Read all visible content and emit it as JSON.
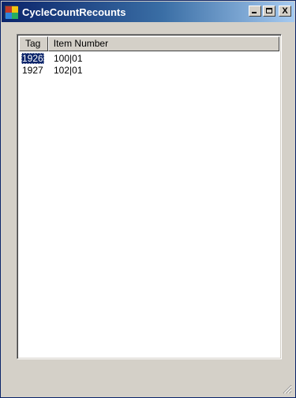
{
  "window": {
    "title": "CycleCountRecounts",
    "icon": "app-window-icon",
    "controls": {
      "minimize_icon": "minimize-icon",
      "maximize_icon": "maximize-icon",
      "close_label": "X"
    }
  },
  "list": {
    "columns": [
      {
        "label": "Tag"
      },
      {
        "label": "Item Number"
      }
    ],
    "rows": [
      {
        "tag": "1926",
        "item_number": "100|01",
        "selected": true
      },
      {
        "tag": "1927",
        "item_number": "102|01",
        "selected": false
      }
    ]
  },
  "colors": {
    "titlebar_start": "#0a246a",
    "titlebar_end": "#a6caf0",
    "selection": "#0a246a",
    "face": "#d4d0c8"
  }
}
